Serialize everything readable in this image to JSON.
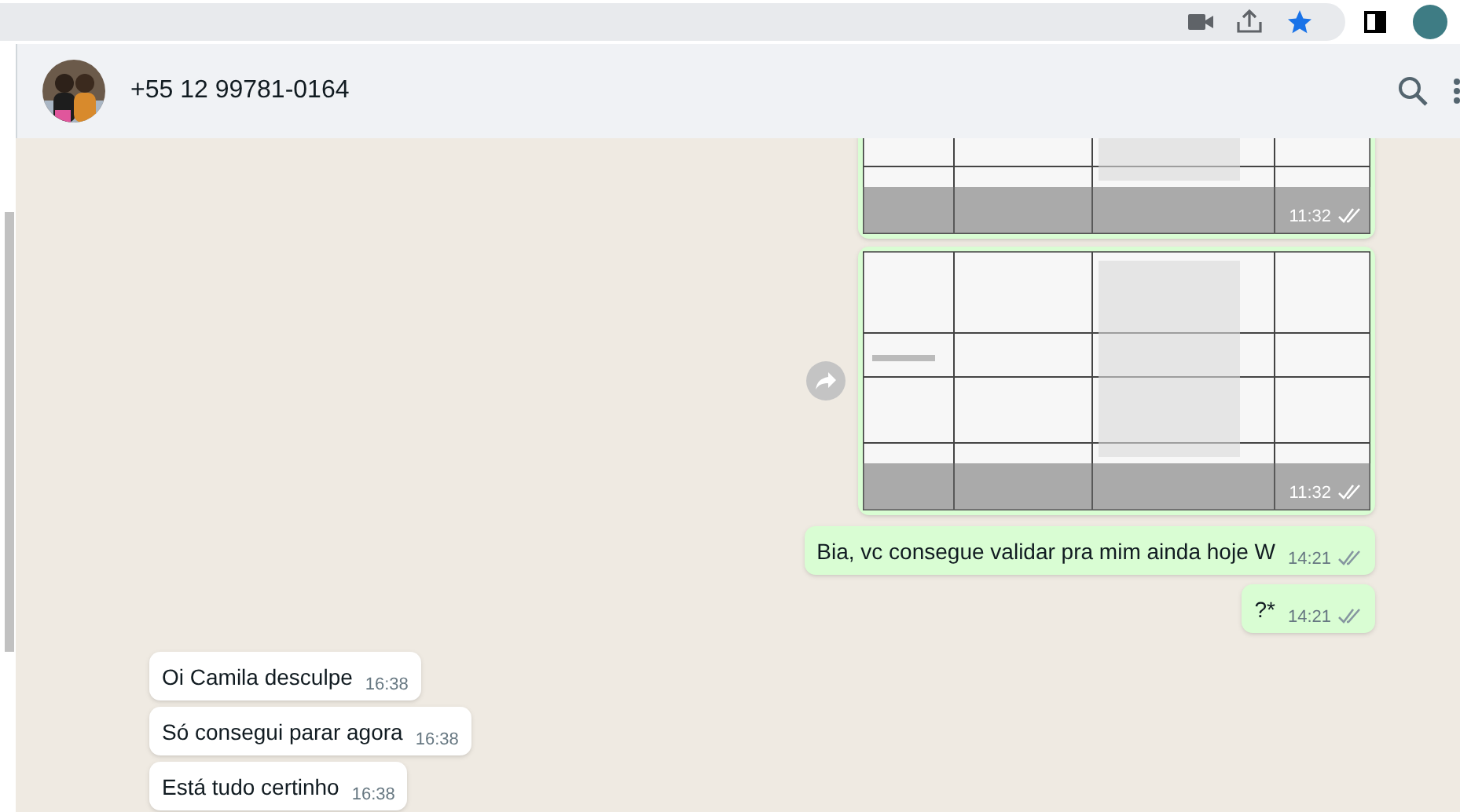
{
  "chat_header": {
    "contact": "+55 12 99781-0164"
  },
  "messages": [
    {
      "outgoing": true,
      "time": "11:32",
      "read": false,
      "forward": false
    },
    {
      "outgoing": true,
      "time": "11:32",
      "read": false,
      "forward": true
    },
    {
      "kind": "text",
      "outgoing": true,
      "text": "Bia, vc consegue validar pra mim ainda hoje W",
      "time": "14:21",
      "read": false
    },
    {
      "kind": "text",
      "outgoing": true,
      "text": "?*",
      "time": "14:21",
      "read": false
    },
    {
      "kind": "text",
      "outgoing": false,
      "text": "Oi Camila desculpe",
      "time": "16:38"
    },
    {
      "kind": "text",
      "outgoing": false,
      "text": "Só consegui parar agora",
      "time": "16:38"
    },
    {
      "kind": "text",
      "outgoing": false,
      "text": "Está tudo certinho",
      "time": "16:38"
    }
  ]
}
